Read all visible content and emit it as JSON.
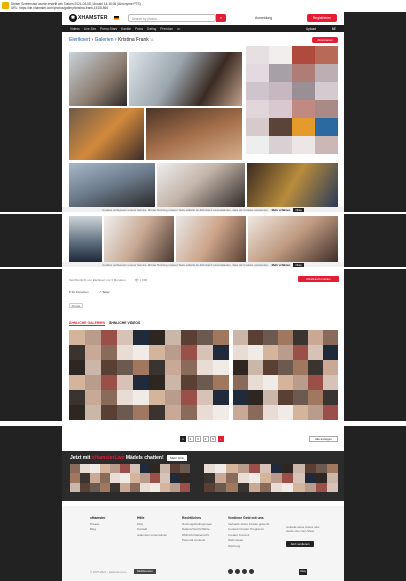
{
  "capture": {
    "line1": "Dieser Screenshot wurde erstellt am: Datum 2021-04-08 | Anzahl 14:16:36 (Akronyme PTS)",
    "line2": "URL: https://de.xhamster.com/photos/gallery/kristina-frank-15151566"
  },
  "header": {
    "logo_text": "XHAMSTER",
    "search_placeholder": "Search by photos...",
    "login_label": "Anmeldung",
    "register_label": "Registrieren"
  },
  "nav": {
    "items": [
      "Videos",
      "Live-Sex",
      "Porno-Stars",
      "Kanäle",
      "Fotos",
      "Dating",
      "Premium",
      "•••"
    ],
    "upload_label": "Upload",
    "user_label": "BE"
  },
  "breadcrumb": {
    "user": "Elerikoert",
    "sep1": " › ",
    "section": "Galerien",
    "sep2": " › ",
    "title": "Kristina Frank",
    "count": "11"
  },
  "subscribe_label": "Abonnieren",
  "cookie": {
    "text": "Cookies verbessern unsere Service. Mit der Nutzung unserer Seite erklärst du dich damit einverstanden, dass wir Cookies verwenden.",
    "more": "Mehr erfahren",
    "ok": "Okay"
  },
  "info": {
    "published": "Veröffentlicht von Elerikoert vor 3 Monaten",
    "views": "1 000",
    "report_label": "Missbrauch melden",
    "favorites_label": "Zu Favoriten",
    "share_label": "Teilen",
    "tag": "Promis"
  },
  "tabs": {
    "similar_galleries": "ÄHNLICHE GALERIEN",
    "similar_videos": "ÄHNLICHE VIDEOS"
  },
  "pager": {
    "pages": [
      "1",
      "2",
      "3",
      "4",
      "5"
    ],
    "next": "›",
    "all_label": "Alle anzeigen"
  },
  "live": {
    "title_pre": "Jetzt mit ",
    "title_brand": "xHamsterLive",
    "title_post": " Mädels chatten!",
    "button": "Mehr Girls"
  },
  "footer": {
    "cols": [
      {
        "head": "xHamster",
        "items": [
          "Presse",
          "Blog"
        ]
      },
      {
        "head": "Hilfe",
        "items": [
          "FAQ",
          "Kontakt",
          "xHamster unterstützen"
        ]
      },
      {
        "head": "Rechtliches",
        "items": [
          "Nutzungsbedingungen",
          "Datenschutzrichtlinie",
          "DMCA/Urheberrecht",
          "Parental Controls"
        ]
      },
      {
        "head": "Verdiene Geld mit uns",
        "items": [
          "Verkaufe deine Inhalte gesucht",
          "Content Creator Programm",
          "Creator Content",
          "Webmaster",
          "Werbung"
        ]
      }
    ],
    "cta_text": "verkaufe deine videos oder werde eine Cam Show",
    "cta_button": "Jetzt verdienen",
    "copyright": "© 2007-2021 - xHamster.com",
    "mobile_label": "Mobilversion"
  },
  "colors": {
    "accent": "#e41d34",
    "dark": "#1e1e1e"
  }
}
